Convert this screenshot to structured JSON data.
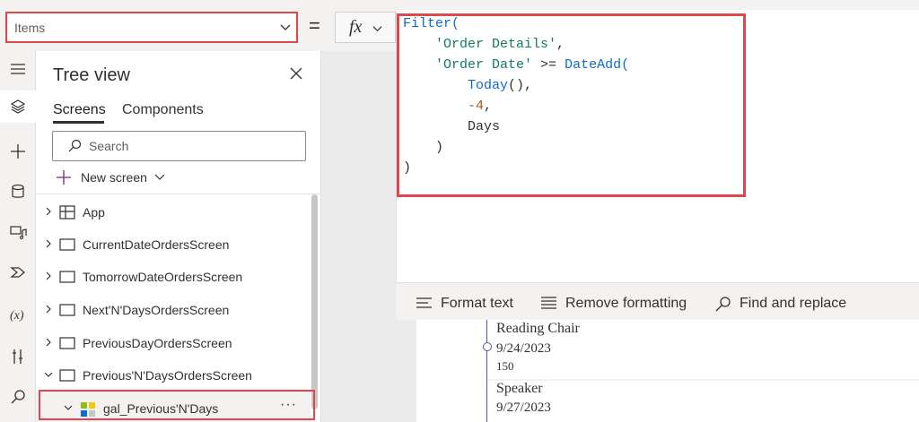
{
  "formula_bar": {
    "property": "Items",
    "equals": "=",
    "fx_label": "fx"
  },
  "formula": {
    "lines": [
      [
        {
          "t": "Filter(",
          "c": "fn"
        }
      ],
      [
        {
          "t": "    ",
          "c": ""
        },
        {
          "t": "'Order Details'",
          "c": "str"
        },
        {
          "t": ",",
          "c": "op"
        }
      ],
      [
        {
          "t": "    ",
          "c": ""
        },
        {
          "t": "'Order Date'",
          "c": "str"
        },
        {
          "t": " >= ",
          "c": "op"
        },
        {
          "t": "DateAdd(",
          "c": "fn"
        }
      ],
      [
        {
          "t": "        ",
          "c": ""
        },
        {
          "t": "Today",
          "c": "fn"
        },
        {
          "t": "(),",
          "c": "op"
        }
      ],
      [
        {
          "t": "        ",
          "c": ""
        },
        {
          "t": "-4",
          "c": "num"
        },
        {
          "t": ",",
          "c": "op"
        }
      ],
      [
        {
          "t": "        Days",
          "c": "op"
        }
      ],
      [
        {
          "t": "    )",
          "c": "op"
        }
      ],
      [
        {
          "t": ")",
          "c": "op"
        }
      ]
    ]
  },
  "editor_toolbar": {
    "format_text": "Format text",
    "remove_formatting": "Remove formatting",
    "find_replace": "Find and replace"
  },
  "tree": {
    "title": "Tree view",
    "tabs": [
      "Screens",
      "Components"
    ],
    "search_placeholder": "Search",
    "new_screen": "New screen",
    "items": [
      {
        "label": "App",
        "type": "app"
      },
      {
        "label": "CurrentDateOrdersScreen",
        "type": "screen"
      },
      {
        "label": "TomorrowDateOrdersScreen",
        "type": "screen"
      },
      {
        "label": "Next'N'DaysOrdersScreen",
        "type": "screen"
      },
      {
        "label": "PreviousDayOrdersScreen",
        "type": "screen"
      },
      {
        "label": "Previous'N'DaysOrdersScreen",
        "type": "screen-expanded"
      },
      {
        "label": "gal_Previous'N'Days",
        "type": "gallery"
      }
    ],
    "more": "···"
  },
  "gallery": {
    "items": [
      {
        "title": "Reading Chair",
        "date": "9/24/2023",
        "qty": "150"
      },
      {
        "title": "Speaker",
        "date": "9/27/2023",
        "qty": ""
      }
    ]
  },
  "colors": {
    "highlight": "#e0464b",
    "accent": "#0e6cc9"
  }
}
